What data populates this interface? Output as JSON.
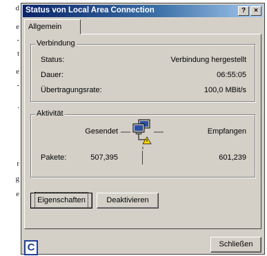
{
  "background_fragments": [
    "d",
    "e",
    "-",
    "t",
    "e",
    "-",
    ".",
    "r",
    "g",
    "e"
  ],
  "window": {
    "title": "Status von Local Area Connection",
    "help_label": "?",
    "close_label": "×"
  },
  "tabs": [
    {
      "label": "Allgemein",
      "selected": true
    }
  ],
  "connection": {
    "title": "Verbindung",
    "rows": [
      {
        "label": "Status:",
        "value": "Verbindung hergestellt"
      },
      {
        "label": "Dauer:",
        "value": "06:55:05"
      },
      {
        "label": "Übertragungsrate:",
        "value": "100,0 MBit/s"
      }
    ]
  },
  "activity": {
    "title": "Aktivität",
    "sent_label": "Gesendet",
    "received_label": "Empfangen",
    "packets_label": "Pakete:",
    "packets_sent": "507,395",
    "packets_received": "601,239"
  },
  "buttons": {
    "properties": "Eigenschaften",
    "disable": "Deaktivieren",
    "close": "Schließen"
  },
  "corner_badge": "C",
  "colors": {
    "dialog_bg": "#d4d0c8",
    "title_start": "#0a246a",
    "title_end": "#a6caf0"
  }
}
